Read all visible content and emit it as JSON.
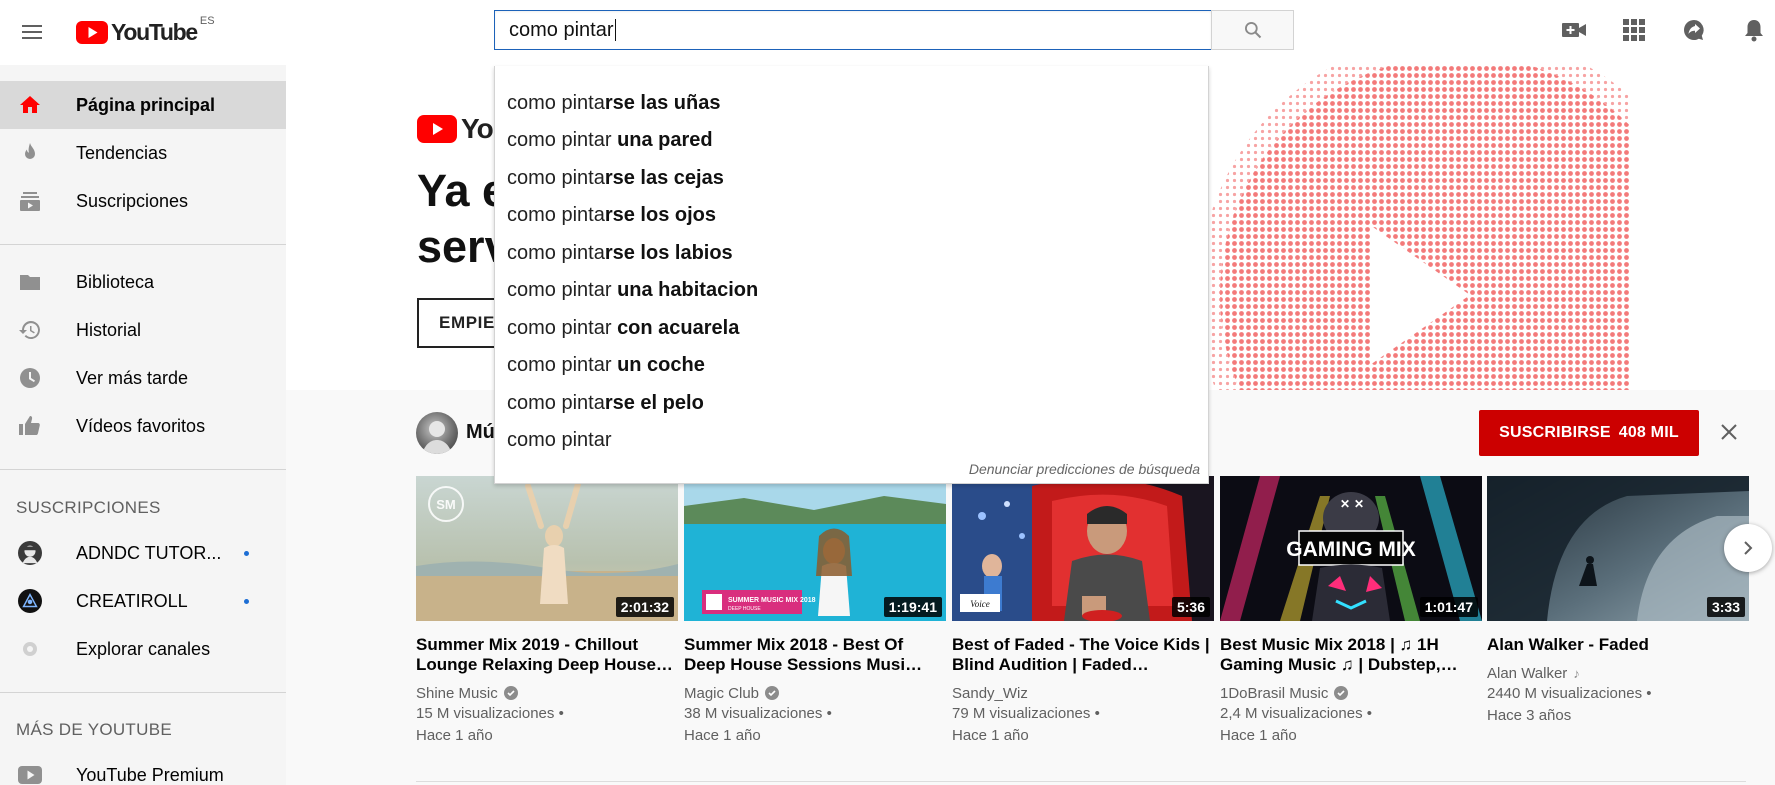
{
  "header": {
    "logo_text": "YouTube",
    "country_code": "ES",
    "search": {
      "value": "como pintar",
      "placeholder": ""
    }
  },
  "sidebar": {
    "primary": [
      {
        "label": "Página principal",
        "icon": "home-icon",
        "active": true
      },
      {
        "label": "Tendencias",
        "icon": "flame-icon"
      },
      {
        "label": "Suscripciones",
        "icon": "subscriptions-icon"
      }
    ],
    "library": [
      {
        "label": "Biblioteca",
        "icon": "folder-icon"
      },
      {
        "label": "Historial",
        "icon": "history-icon"
      },
      {
        "label": "Ver más tarde",
        "icon": "clock-icon"
      },
      {
        "label": "Vídeos favoritos",
        "icon": "thumbs-up-icon"
      }
    ],
    "subscriptions_heading": "SUSCRIPCIONES",
    "subscriptions": [
      {
        "label": "ADNDC TUTOR...",
        "has_new": true
      },
      {
        "label": "CREATIROLL",
        "has_new": true
      },
      {
        "label": "Explorar canales",
        "has_new": false
      }
    ],
    "more_heading": "MÁS DE YOUTUBE",
    "more": [
      {
        "label": "YouTube Premium",
        "icon": "youtube-icon"
      }
    ]
  },
  "banner": {
    "logo_text": "Yo",
    "heading": "Ya e\nserv",
    "button_label": "EMPIEZ"
  },
  "shelf": {
    "title": "Mú",
    "subscribe_label": "SUSCRIBIRSE",
    "subscriber_count": "408 MIL",
    "videos": [
      {
        "title": "Summer Mix 2019 - Chillout Lounge Relaxing Deep House…",
        "channel": "Shine Music",
        "verified": true,
        "views": "15 M visualizaciones •",
        "age": "Hace 1 año",
        "duration": "2:01:32"
      },
      {
        "title": "Summer Mix 2018 - Best Of Deep House Sessions Musi…",
        "channel": "Magic Club",
        "verified": true,
        "views": "38 M visualizaciones •",
        "age": "Hace 1 año",
        "duration": "1:19:41"
      },
      {
        "title": "Best of Faded - The Voice Kids | Blind Audition | Faded…",
        "channel": "Sandy_Wiz",
        "verified": false,
        "views": "79 M visualizaciones •",
        "age": "Hace 1 año",
        "duration": "5:36"
      },
      {
        "title": "Best Music Mix 2018 | ♫ 1H Gaming Music ♫ | Dubstep,…",
        "channel": "1DoBrasil Music",
        "verified": true,
        "views": "2,4 M visualizaciones •",
        "age": "Hace 1 año",
        "duration": "1:01:47"
      },
      {
        "title": "Alan Walker - Faded",
        "channel": "Alan Walker",
        "music_note": true,
        "views": "2440 M visualizaciones •",
        "age": "Hace 3 años",
        "duration": "3:33"
      }
    ]
  },
  "suggestions": {
    "items": [
      {
        "prefix": "como pinta",
        "suffix": "rse las uñas"
      },
      {
        "prefix": "como pintar ",
        "suffix": "una pared"
      },
      {
        "prefix": "como pinta",
        "suffix": "rse las cejas"
      },
      {
        "prefix": "como pinta",
        "suffix": "rse los ojos"
      },
      {
        "prefix": "como pinta",
        "suffix": "rse los labios"
      },
      {
        "prefix": "como pintar ",
        "suffix": "una habitacion"
      },
      {
        "prefix": "como pintar ",
        "suffix": "con acuarela"
      },
      {
        "prefix": "como pintar ",
        "suffix": "un coche"
      },
      {
        "prefix": "como pinta",
        "suffix": "rse el pelo"
      },
      {
        "prefix": "como pintar",
        "suffix": ""
      }
    ],
    "report_label": "Denunciar predicciones de búsqueda"
  },
  "colors": {
    "brand_red": "#ff0000",
    "subscribe_red": "#cc0000",
    "search_focus": "#1c62b9",
    "new_dot": "#1d6ed4"
  }
}
